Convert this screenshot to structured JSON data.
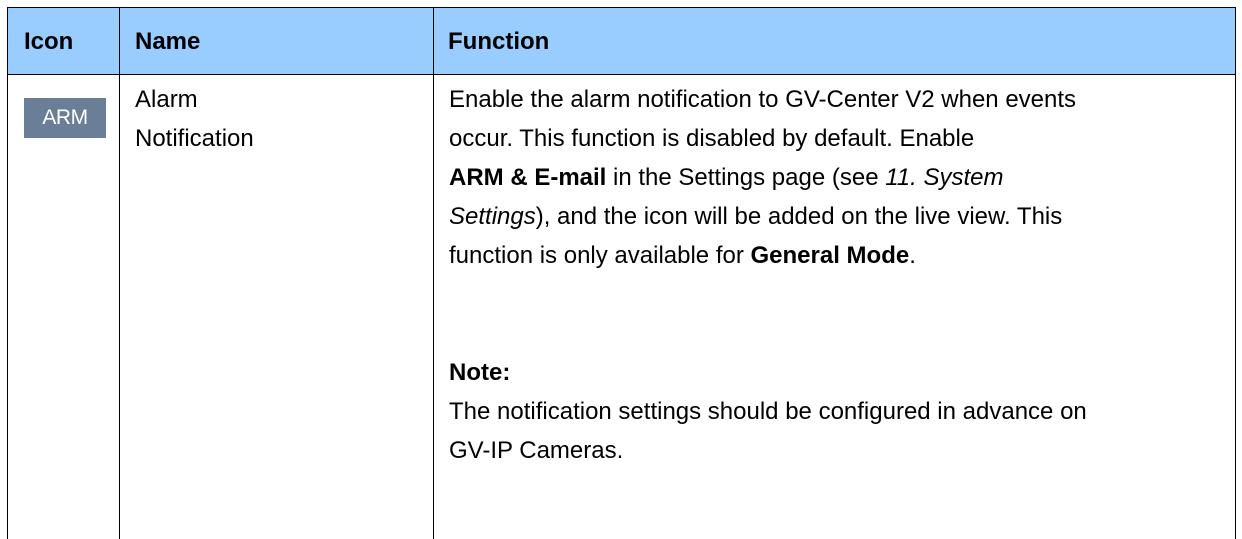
{
  "header": {
    "icon": "Icon",
    "name": "Name",
    "function": "Function"
  },
  "row": {
    "icon_label": "ARM",
    "name_line1": "Alarm",
    "name_line2": "Notification",
    "func": {
      "l1": "Enable the alarm notification to GV-Center V2 when events",
      "l2": "occur. This function is disabled by default. Enable",
      "l3_bold": "ARM & E-mail",
      "l3_text": " in the Settings page (see ",
      "l3_italic": "11. System",
      "l4_italic": "Settings",
      "l4_text": "), and the icon will be added on the live view. This",
      "l5_text": "function is only available for ",
      "l5_bold": "General Mode",
      "l5_end": ".",
      "note_label": "Note:",
      "note_l1": "The notification settings should be configured in advance on",
      "note_l2": "GV-IP Cameras."
    }
  },
  "colors": {
    "header_bg": "#99ccff",
    "icon_bg": "#6a7e97"
  }
}
